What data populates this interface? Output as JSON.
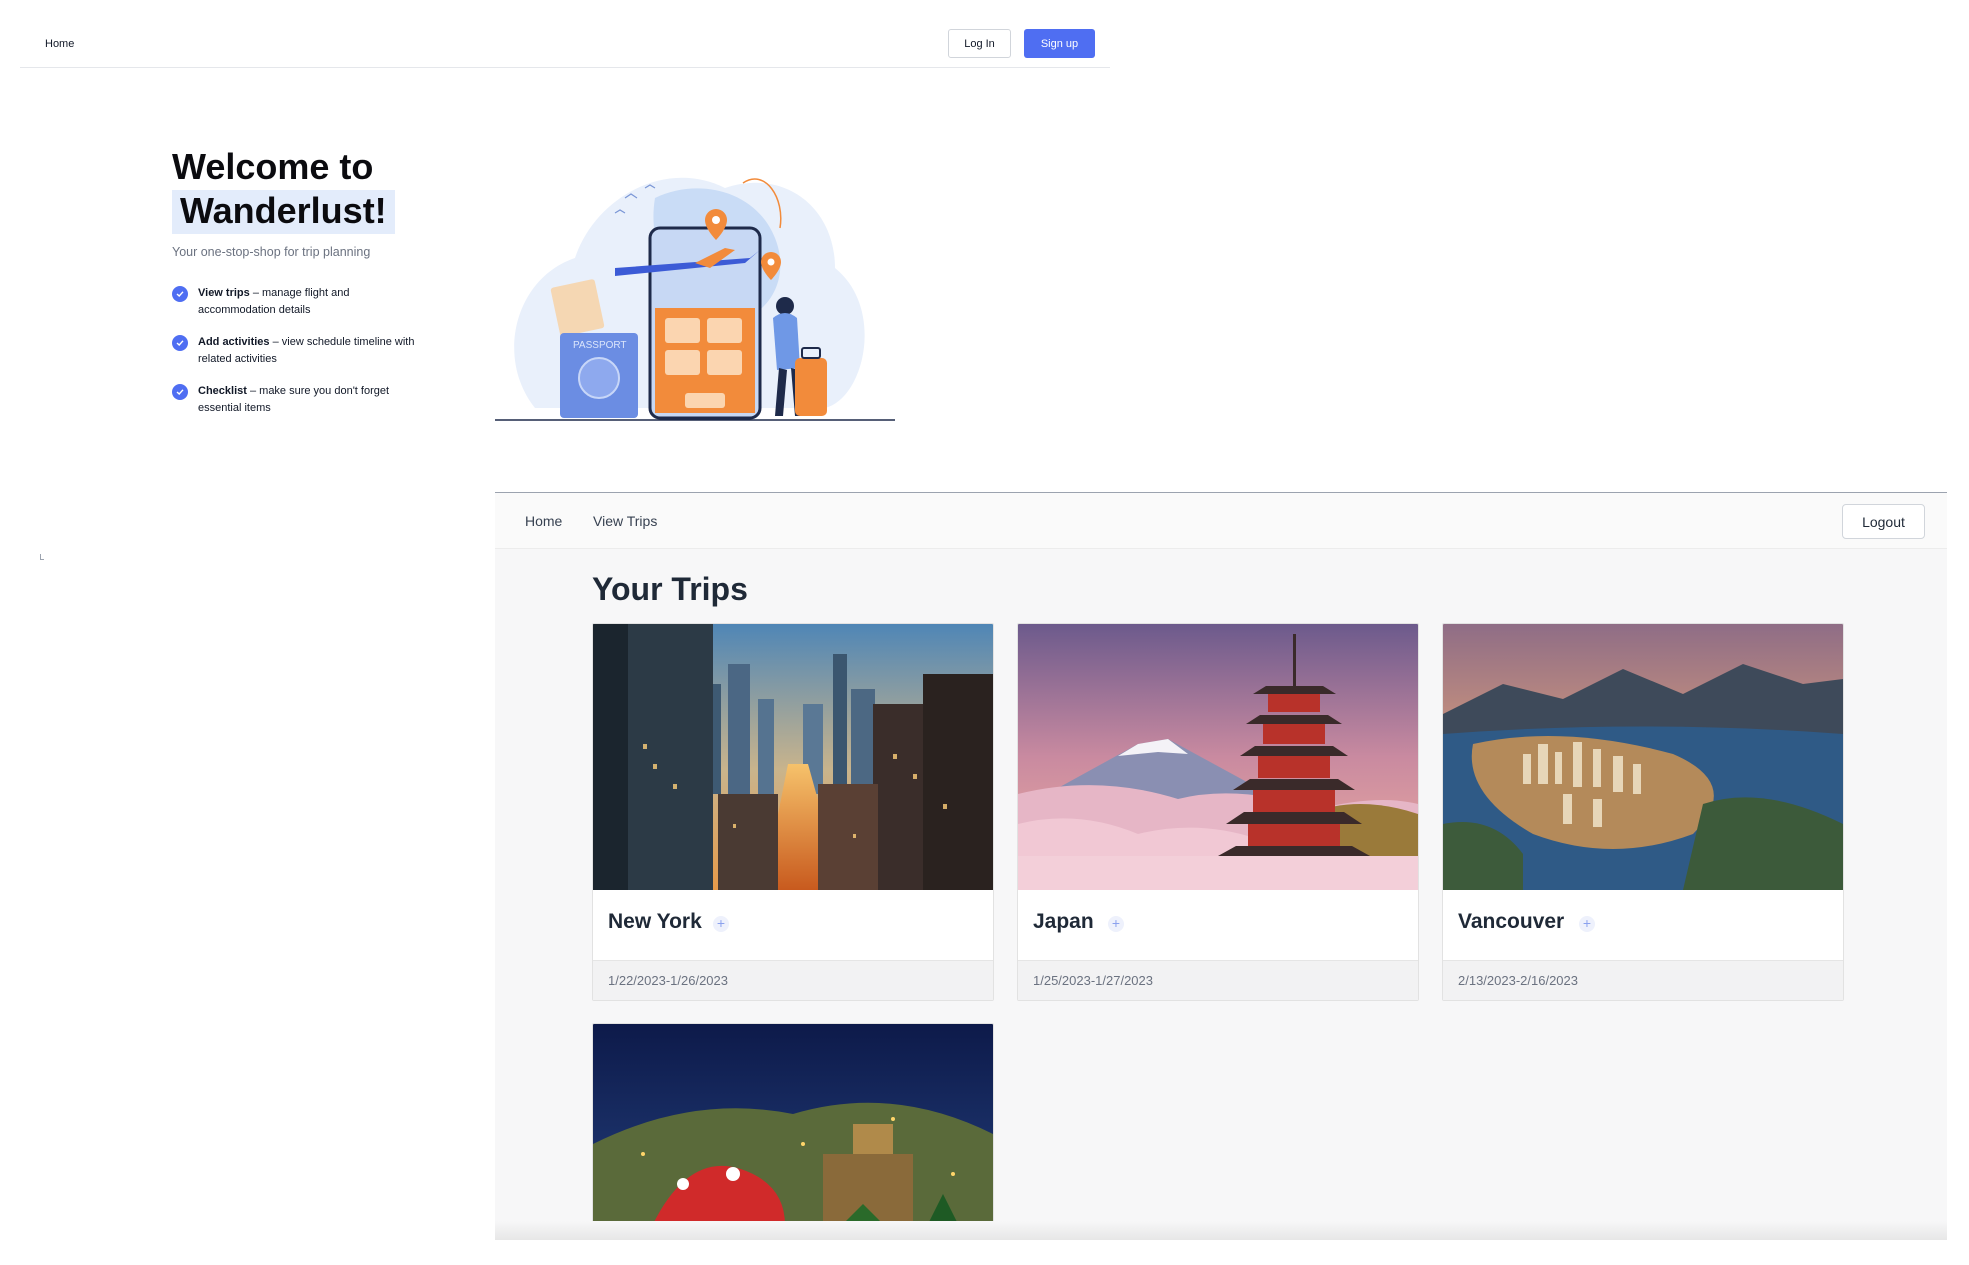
{
  "landing": {
    "nav": {
      "home": "Home",
      "login": "Log In",
      "signup": "Sign up"
    },
    "hero": {
      "title_line1": "Welcome to",
      "title_line2": "Wanderlust!",
      "subtitle": "Your one-stop-shop for trip planning",
      "features": [
        {
          "title": "View trips",
          "desc": " – manage flight and accommodation details"
        },
        {
          "title": "Add activities",
          "desc": " – view schedule timeline with related activities"
        },
        {
          "title": "Checklist",
          "desc": " – make sure you don't forget essential items"
        }
      ],
      "illustration_text": "PASSPORT"
    },
    "colors": {
      "accent": "#4f6ef2",
      "highlight": "#e3ecfb"
    }
  },
  "app": {
    "nav": {
      "home": "Home",
      "view_trips": "View Trips",
      "logout": "Logout"
    },
    "page_title": "Your Trips",
    "trips": [
      {
        "name": "New York",
        "dates": "1/22/2023-1/26/2023",
        "image": "new-york-street-photo"
      },
      {
        "name": "Japan",
        "dates": "1/25/2023-1/27/2023",
        "image": "japan-pagoda-photo"
      },
      {
        "name": "Vancouver",
        "dates": "2/13/2023-2/16/2023",
        "image": "vancouver-aerial-photo"
      },
      {
        "name": "",
        "dates": "",
        "image": "theme-park-night-photo"
      }
    ],
    "add_symbol": "+"
  }
}
